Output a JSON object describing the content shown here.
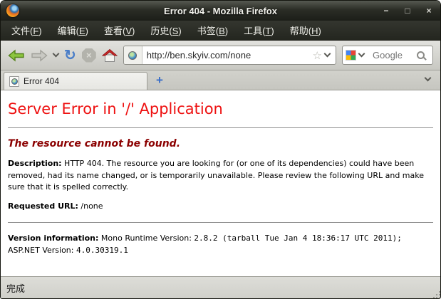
{
  "window": {
    "title": "Error 404 - Mozilla Firefox",
    "controls": {
      "minimize": "−",
      "maximize": "□",
      "close": "×"
    }
  },
  "menubar": {
    "items": [
      {
        "pre": "文件(",
        "accel": "F",
        "post": ")"
      },
      {
        "pre": "编辑(",
        "accel": "E",
        "post": ")"
      },
      {
        "pre": "查看(",
        "accel": "V",
        "post": ")"
      },
      {
        "pre": "历史(",
        "accel": "S",
        "post": ")"
      },
      {
        "pre": "书签(",
        "accel": "B",
        "post": ")"
      },
      {
        "pre": "工具(",
        "accel": "T",
        "post": ")"
      },
      {
        "pre": "帮助(",
        "accel": "H",
        "post": ")"
      }
    ]
  },
  "toolbar": {
    "url_value": "http://ben.skyiv.com/none",
    "search_placeholder": "Google",
    "icons": {
      "refresh": "↻",
      "stop": "×",
      "star": "☆"
    }
  },
  "tabbar": {
    "active_tab_label": "Error 404",
    "new_tab_glyph": "+"
  },
  "page": {
    "heading": "Server Error in '/' Application",
    "subheading": "The resource cannot be found.",
    "description_label": "Description:",
    "description_text": " HTTP 404. The resource you are looking for (or one of its dependencies) could have been removed, had its name changed, or is temporarily unavailable. Please review the following URL and make sure that it is spelled correctly.",
    "requested_url_label": "Requested URL:",
    "requested_url_value": " /none",
    "version_label": "Version information:",
    "version_runtime_label": " Mono Runtime Version: ",
    "version_runtime_value": "2.8.2  (tarball Tue Jan 4 18:36:17 UTC 2011);",
    "version_aspnet_label": " ASP.NET Version: ",
    "version_aspnet_value": "4.0.30319.1"
  },
  "statusbar": {
    "text": "完成"
  },
  "colors": {
    "heading_red": "#ee1111",
    "subheading_maroon": "#8b0000",
    "titlebar_dark": "#23251f",
    "back_arrow_green": "#8dc63f",
    "refresh_blue": "#4a7ec8"
  }
}
